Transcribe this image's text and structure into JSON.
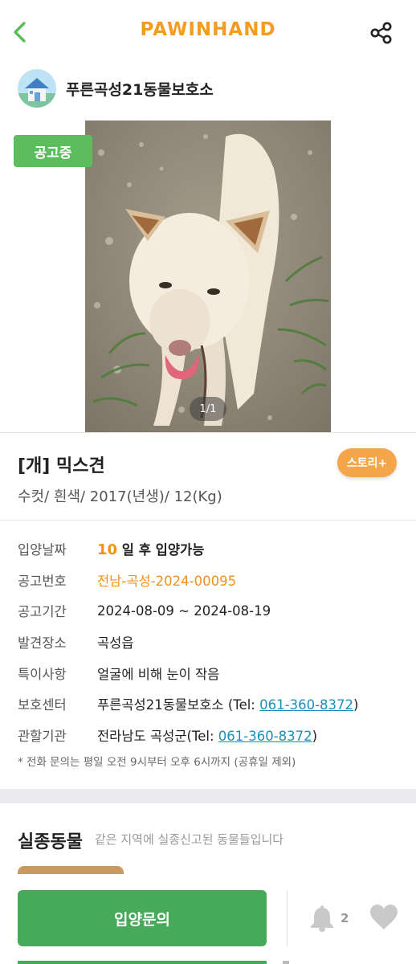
{
  "header": {
    "brand": "PAWINHAND",
    "back_icon": "chevron-left-icon",
    "share_icon": "share-icon",
    "brand_color": "#f39c1f"
  },
  "shelter": {
    "name": "푸른곡성21동물보호소",
    "logo_icon": "house-icon"
  },
  "photo": {
    "status_badge": "공고중",
    "pager": "1/1"
  },
  "animal": {
    "title": "[개] 믹스견",
    "story_button": "스토리+",
    "summary": "수컷/ 흰색/ 2017(년생)/ 12(Kg)"
  },
  "details": {
    "adopt_date_label": "입양날짜",
    "adopt_days": "10",
    "adopt_days_tail": " 일 후 입양가능",
    "notice_no_label": "공고번호",
    "notice_no": "전남-곡성-2024-00095",
    "period_label": "공고기간",
    "period": "2024-08-09 ~ 2024-08-19",
    "found_place_label": "발견장소",
    "found_place": "곡성읍",
    "feature_label": "특이사항",
    "feature": "얼굴에 비해 눈이 작음",
    "center_label": "보호센터",
    "center_prefix": "푸른곡성21동물보호소 (Tel: ",
    "center_tel": "061-360-8372",
    "center_suffix": ")",
    "agency_label": "관할기관",
    "agency_prefix": "전라남도 곡성군(Tel: ",
    "agency_tel": "061-360-8372",
    "agency_suffix": ")",
    "note": "* 전화 문의는 평일 오전 9시부터 오후 6시까지 (공휴일 제외)"
  },
  "missing": {
    "title": "실종동물",
    "subtitle": "같은 지역에 실종신고된 동물들입니다"
  },
  "bottom": {
    "adopt_button": "입양문의",
    "bell_count": "2",
    "adopt_color": "#47a95a"
  }
}
